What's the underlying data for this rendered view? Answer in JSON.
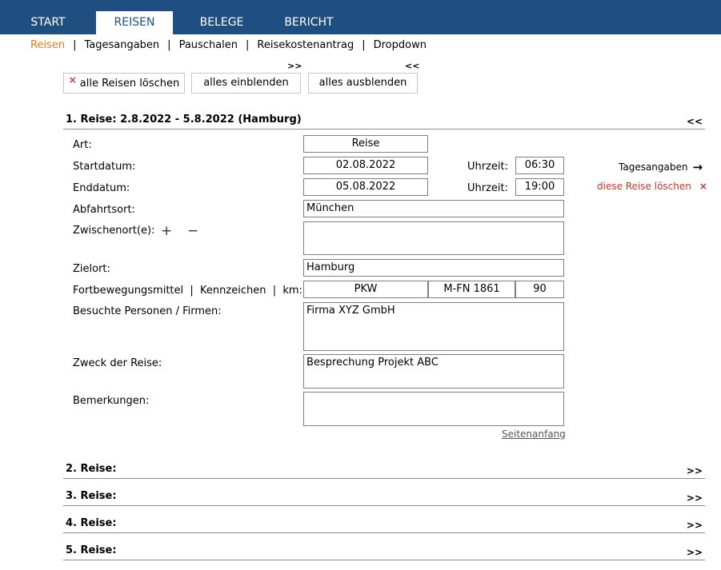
{
  "top_tabs": [
    {
      "label": "START"
    },
    {
      "label": "REISEN"
    },
    {
      "label": "BELEGE"
    },
    {
      "label": "BERICHT"
    }
  ],
  "active_tab": "REISEN",
  "sub_nav": [
    {
      "label": "Reisen"
    },
    {
      "label": "Tagesangaben"
    },
    {
      "label": "Pauschalen"
    },
    {
      "label": "Reisekostenantrag"
    },
    {
      "label": "Dropdown"
    }
  ],
  "sub_nav_separator": "|",
  "expand_all_marker": ">>",
  "collapse_all_marker": "<<",
  "toolbar": {
    "delete_all_icon": "×",
    "delete_all_label": "alle Reisen löschen",
    "show_all_label": "alles einblenden",
    "hide_all_label": "alles ausblenden"
  },
  "trip1": {
    "title": "1. Reise: 2.8.2022 - 5.8.2022 (Hamburg)",
    "toggle": "<<",
    "labels": {
      "art": "Art:",
      "startdatum": "Startdatum:",
      "enddatum": "Enddatum:",
      "abfahrtsort": "Abfahrtsort:",
      "zwischenort": "Zwischenort(e):",
      "zielort": "Zielort:",
      "fortbewegung": "Fortbewegungsmittel  |  Kennzeichen  |  km:",
      "besuchte": "Besuchte Personen / Firmen:",
      "zweck": "Zweck der Reise:",
      "bemerkungen": "Bemerkungen:",
      "uhrzeit": "Uhrzeit:"
    },
    "values": {
      "art": "Reise",
      "startdatum": "02.08.2022",
      "start_uhrzeit": "06:30",
      "enddatum": "05.08.2022",
      "end_uhrzeit": "19:00",
      "abfahrtsort": "München",
      "zwischenort": "",
      "zielort": "Hamburg",
      "fortbewegungsmittel": "PKW",
      "kennzeichen": "M-FN 1861",
      "km": "90",
      "besuchte": "Firma XYZ GmbH",
      "zweck": "Besprechung Projekt ABC",
      "bemerkungen": ""
    },
    "add_icon": "+",
    "remove_icon": "−",
    "side_tagesangaben": "Tagesangaben",
    "side_tagesangaben_icon": "→",
    "side_delete": "diese Reise löschen",
    "side_delete_icon": "×",
    "top_link": "Seitenanfang"
  },
  "collapsed_trips": [
    {
      "title": "2. Reise:",
      "toggle": ">>"
    },
    {
      "title": "3. Reise:",
      "toggle": ">>"
    },
    {
      "title": "4. Reise:",
      "toggle": ">>"
    },
    {
      "title": "5. Reise:",
      "toggle": ">>"
    }
  ],
  "colors": {
    "ribbon": "#1f4e80",
    "active_subnav": "#e07b24",
    "delete_red": "#c0392b"
  }
}
